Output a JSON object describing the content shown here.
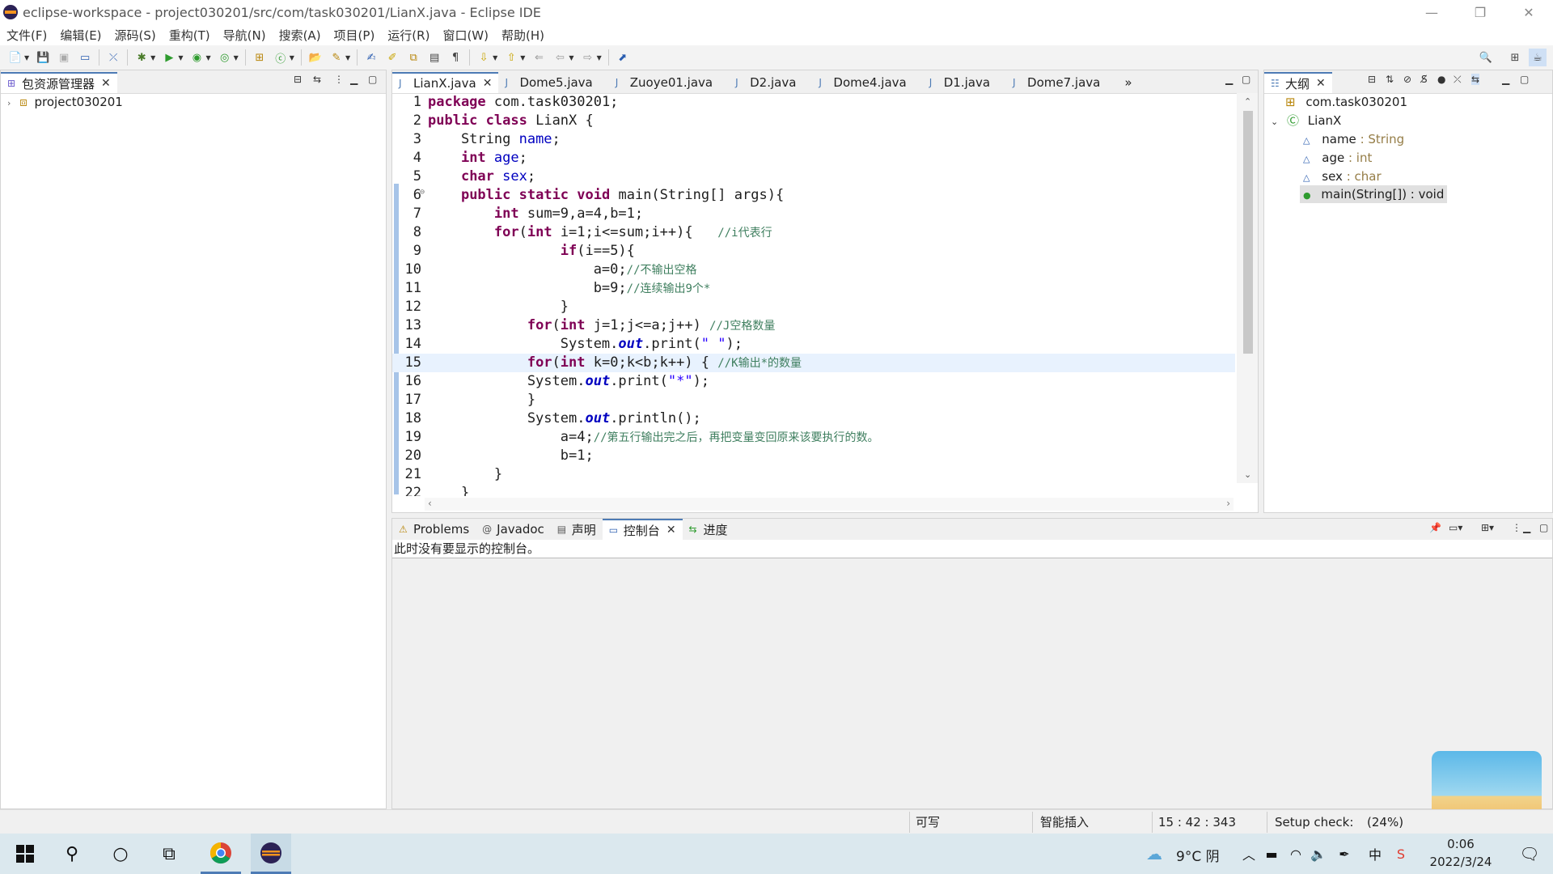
{
  "window": {
    "title": "eclipse-workspace - project030201/src/com/task030201/LianX.java - Eclipse IDE",
    "minimize": "—",
    "restore": "❐",
    "close": "✕"
  },
  "menu": [
    "文件(F)",
    "编辑(E)",
    "源码(S)",
    "重构(T)",
    "导航(N)",
    "搜索(A)",
    "项目(P)",
    "运行(R)",
    "窗口(W)",
    "帮助(H)"
  ],
  "package_explorer": {
    "tab_label": "包资源管理器",
    "project": "project030201"
  },
  "editor": {
    "tabs": [
      "LianX.java",
      "Dome5.java",
      "Zuoye01.java",
      "D2.java",
      "Dome4.java",
      "D1.java",
      "Dome7.java"
    ],
    "overflow": "»",
    "line_numbers": [
      "1",
      "2",
      "3",
      "4",
      "5",
      "6",
      "7",
      "8",
      "9",
      "10",
      "11",
      "12",
      "13",
      "14",
      "15",
      "16",
      "17",
      "18",
      "19",
      "20",
      "21",
      "22"
    ],
    "lines": [
      [
        [
          "kw",
          "package"
        ],
        [
          "p",
          " com.task030201;"
        ]
      ],
      [
        [
          "kw",
          "public"
        ],
        [
          "p",
          " "
        ],
        [
          "kw",
          "class"
        ],
        [
          "p",
          " LianX {"
        ]
      ],
      [
        [
          "p",
          "    String "
        ],
        [
          "fld",
          "name"
        ],
        [
          "p",
          ";"
        ]
      ],
      [
        [
          "p",
          "    "
        ],
        [
          "kw",
          "int"
        ],
        [
          "p",
          " "
        ],
        [
          "fld",
          "age"
        ],
        [
          "p",
          ";"
        ]
      ],
      [
        [
          "p",
          "    "
        ],
        [
          "kw",
          "char"
        ],
        [
          "p",
          " "
        ],
        [
          "fld",
          "sex"
        ],
        [
          "p",
          ";"
        ]
      ],
      [
        [
          "p",
          "    "
        ],
        [
          "kw",
          "public"
        ],
        [
          "p",
          " "
        ],
        [
          "kw",
          "static"
        ],
        [
          "p",
          " "
        ],
        [
          "kw",
          "void"
        ],
        [
          "p",
          " main(String[] args){"
        ]
      ],
      [
        [
          "p",
          "        "
        ],
        [
          "kw",
          "int"
        ],
        [
          "p",
          " sum=9,a=4,b=1;"
        ]
      ],
      [
        [
          "p",
          "        "
        ],
        [
          "kw",
          "for"
        ],
        [
          "p",
          "("
        ],
        [
          "kw",
          "int"
        ],
        [
          "p",
          " i=1;i<=sum;i++){   "
        ],
        [
          "cmt",
          "//i代表行"
        ]
      ],
      [
        [
          "p",
          "                "
        ],
        [
          "kw",
          "if"
        ],
        [
          "p",
          "(i==5){"
        ]
      ],
      [
        [
          "p",
          "                    a=0;"
        ],
        [
          "cmt",
          "//不输出空格"
        ]
      ],
      [
        [
          "p",
          "                    b=9;"
        ],
        [
          "cmt",
          "//连续输出9个*"
        ]
      ],
      [
        [
          "p",
          "                }"
        ]
      ],
      [
        [
          "p",
          "            "
        ],
        [
          "kw",
          "for"
        ],
        [
          "p",
          "("
        ],
        [
          "kw",
          "int"
        ],
        [
          "p",
          " j=1;j<=a;j++) "
        ],
        [
          "cmt",
          "//J空格数量"
        ]
      ],
      [
        [
          "p",
          "                System."
        ],
        [
          "sfld",
          "out"
        ],
        [
          "p",
          ".print("
        ],
        [
          "str",
          "\" \""
        ],
        [
          "p",
          ");"
        ]
      ],
      [
        [
          "p",
          "            "
        ],
        [
          "kw",
          "for"
        ],
        [
          "p",
          "("
        ],
        [
          "kw",
          "int"
        ],
        [
          "p",
          " k=0;k<b;k++) { "
        ],
        [
          "cmt",
          "//K输出*的数量"
        ]
      ],
      [
        [
          "p",
          "            System."
        ],
        [
          "sfld",
          "out"
        ],
        [
          "p",
          ".print("
        ],
        [
          "str",
          "\"*\""
        ],
        [
          "p",
          ");"
        ]
      ],
      [
        [
          "p",
          "            }"
        ]
      ],
      [
        [
          "p",
          "            System."
        ],
        [
          "sfld",
          "out"
        ],
        [
          "p",
          ".println();"
        ]
      ],
      [
        [
          "p",
          "                a=4;"
        ],
        [
          "cmt",
          "//第五行输出完之后，再把变量变回原来该要执行的数。"
        ]
      ],
      [
        [
          "p",
          "                b=1;"
        ]
      ],
      [
        [
          "p",
          "        }"
        ]
      ],
      [
        [
          "p",
          "    }"
        ]
      ]
    ],
    "highlight_line": 15
  },
  "outline": {
    "tab_label": "大纲",
    "package": "com.task030201",
    "class": "LianX",
    "members": [
      {
        "name": "name",
        "type": " : String"
      },
      {
        "name": "age",
        "type": " : int"
      },
      {
        "name": "sex",
        "type": " : char"
      },
      {
        "name": "main(String[]) : void",
        "type": ""
      }
    ]
  },
  "bottom_panel": {
    "tabs": [
      "Problems",
      "Javadoc",
      "声明",
      "控制台",
      "进度"
    ],
    "message": "此时没有要显示的控制台。"
  },
  "status": {
    "writable": "可写",
    "insert_mode": "智能插入",
    "position": "15 : 42 : 343",
    "setup": "Setup check:",
    "setup_pct": "(24%)"
  },
  "ime": {
    "label": "中 °, ☽ 👕"
  },
  "taskbar": {
    "weather": "9°C 阴",
    "time": "0:06",
    "date": "2022/3/24",
    "ime": "中"
  },
  "colors": {
    "accent": "#4d7bb5",
    "keyword": "#7f0055",
    "field": "#0000c0",
    "comment": "#3f7f5f",
    "string": "#2a00ff"
  }
}
